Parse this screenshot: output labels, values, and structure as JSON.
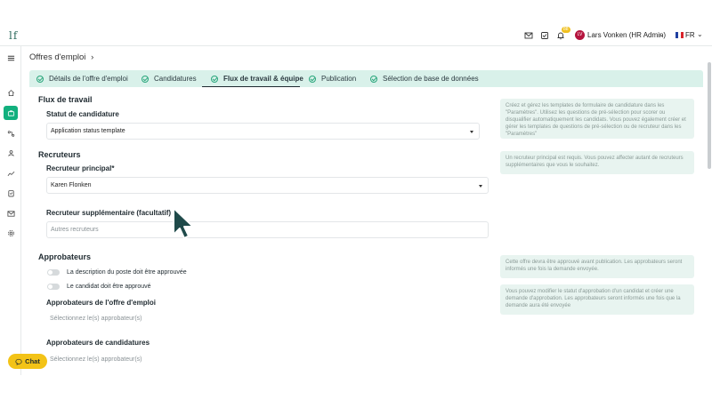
{
  "app": {
    "logo_text": "lf"
  },
  "header": {
    "notification_count": "88",
    "user": {
      "initials": "LV",
      "name": "Lars Vonken (HR Admin)"
    },
    "language": "FR"
  },
  "page": {
    "breadcrumb": "Offres d'emploi",
    "breadcrumb_chevron": "›"
  },
  "tabs": [
    {
      "label": "Détails de l'offre d'emploi",
      "active": false
    },
    {
      "label": "Candidatures",
      "active": false
    },
    {
      "label": "Flux de travail & équipe",
      "active": true
    },
    {
      "label": "Publication",
      "active": false
    },
    {
      "label": "Sélection de base de données",
      "active": false
    }
  ],
  "workflow": {
    "title": "Flux de travail",
    "status_label": "Statut de candidature",
    "status_value": "Application status template",
    "info": "Créez et gérez les templates de formulaire de candidature dans les \"Paramètres\". Utilisez les questions de pré-sélection pour scorer ou disqualifier automatiquement les candidats. Vous pouvez également créer et gérer les templates de questions de pré-sélection ou de recruteur dans les \"Paramètres\""
  },
  "recruiters": {
    "title": "Recruteurs",
    "main_label": "Recruteur principal*",
    "main_value": "Karen Flonken",
    "extra_label": "Recruteur supplémentaire (facultatif)",
    "extra_placeholder": "Autres recruteurs",
    "info": "Un recruteur principal est requis. Vous pouvez affecter autant de recruteurs supplémentaires que vous le souhaitez."
  },
  "approvers": {
    "title": "Approbateurs",
    "toggle_job": "La description du poste doit être approuvée",
    "toggle_candidate": "Le candidat doit être approuvé",
    "job_label": "Approbateurs de l'offre d'emploi",
    "job_placeholder": "Sélectionnez le(s) approbateur(s)",
    "cand_label": "Approbateurs de candidatures",
    "cand_placeholder": "Sélectionnez le(s) approbateur(s)",
    "info_job": "Cette offre devra être approuvé avant publication. Les approbateurs seront informés une fois la demande envoyée.",
    "info_cand": "Vous pouvez modifier le statut d'approbation d'un candidat et créer une demande d'approbation. Les approbateurs seront informés une fois que la demande aura été envoyée"
  },
  "chat": {
    "label": "Chat"
  },
  "colors": {
    "accent": "#12b07e",
    "tab_bg": "#d9f1ea",
    "chat": "#f3c317",
    "cursor": "#1f4a4a"
  }
}
